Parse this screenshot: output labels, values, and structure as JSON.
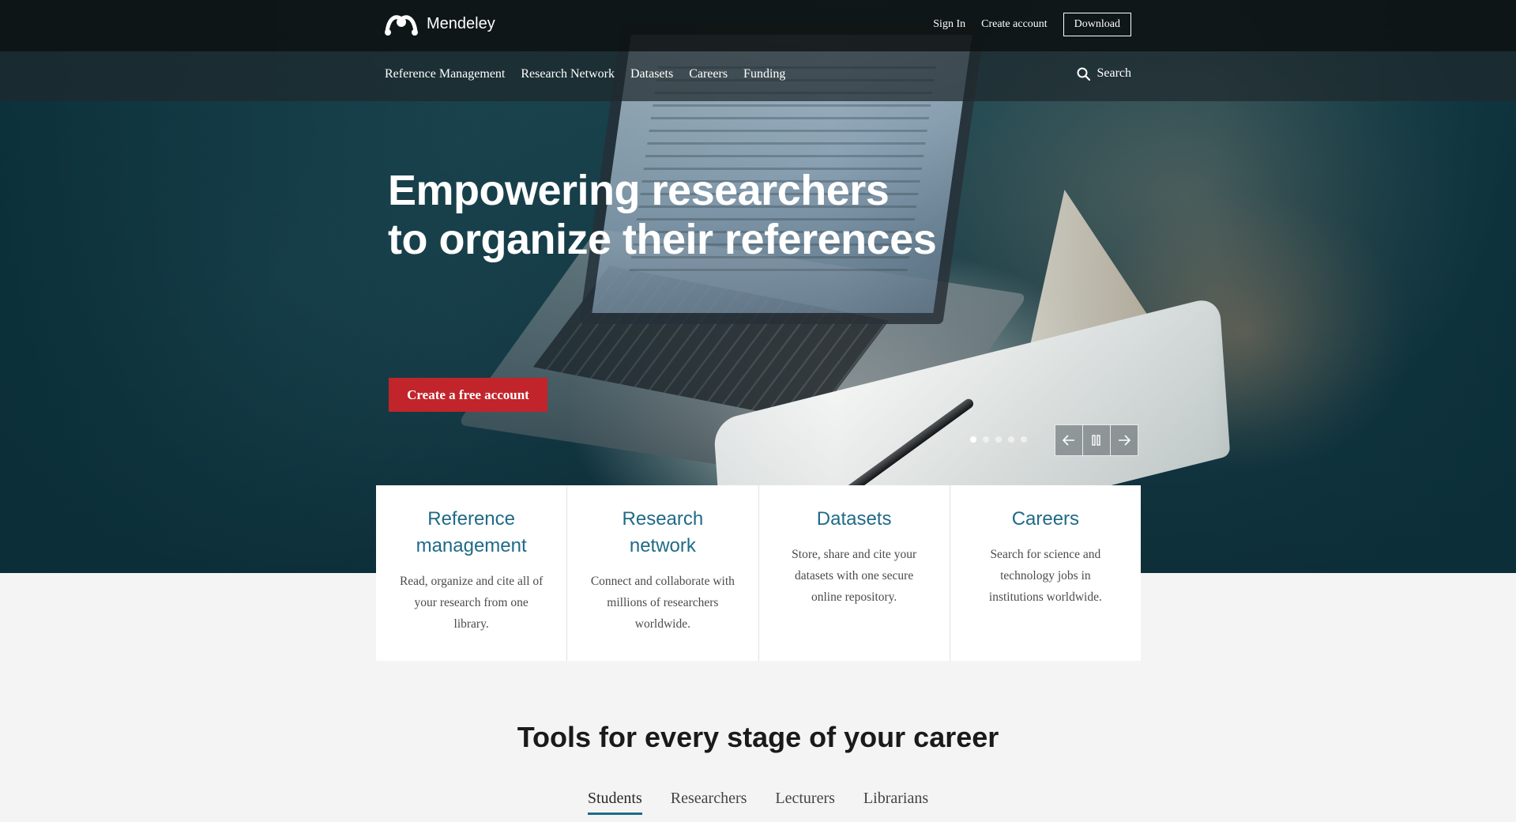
{
  "header": {
    "brand": "Mendeley",
    "links": {
      "sign_in": "Sign In",
      "create_account": "Create account",
      "download": "Download"
    }
  },
  "nav": {
    "items": [
      "Reference Management",
      "Research Network",
      "Datasets",
      "Careers",
      "Funding"
    ],
    "search_label": "Search"
  },
  "hero": {
    "headline_line1": "Empowering researchers",
    "headline_line2": "to organize their references",
    "cta_label": "Create a free account",
    "carousel_slides": 5,
    "carousel_active_index": 0
  },
  "features": [
    {
      "title": "Reference management",
      "description": "Read, organize and cite all of your research from one library."
    },
    {
      "title": "Research network",
      "description": "Connect and collaborate with millions of researchers worldwide."
    },
    {
      "title": "Datasets",
      "description": "Store, share and cite your datasets with one secure online repository."
    },
    {
      "title": "Careers",
      "description": "Search for science and technology jobs in institutions worldwide."
    }
  ],
  "tools": {
    "title": "Tools for every stage of your career",
    "tabs": [
      "Students",
      "Researchers",
      "Lecturers",
      "Librarians"
    ],
    "active_tab": "Students"
  },
  "colors": {
    "accent_red": "#c1252b",
    "link_blue": "#1f6a87",
    "topbar": "#0e1214"
  }
}
